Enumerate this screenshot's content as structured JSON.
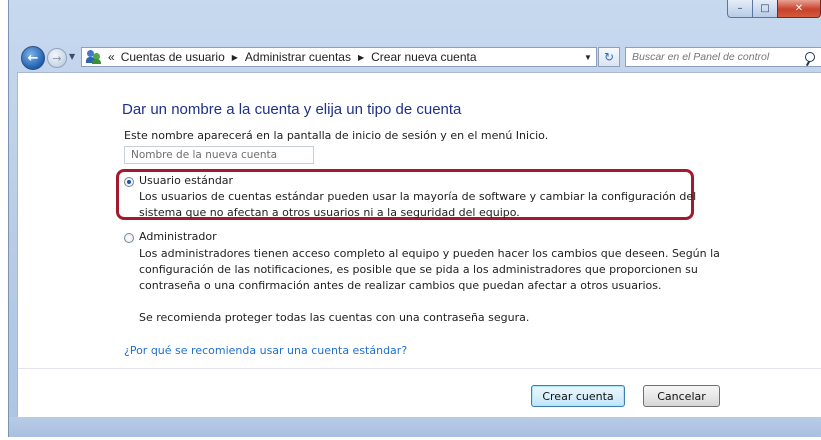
{
  "window": {
    "minimize_glyph": "–",
    "maximize_glyph": "□",
    "close_glyph": "✕"
  },
  "nav": {
    "back_glyph": "←",
    "forward_glyph": "→",
    "breadcrumb_prefix": "«",
    "breadcrumb": [
      "Cuentas de usuario",
      "Administrar cuentas",
      "Crear nueva cuenta"
    ],
    "refresh_glyph": "↻",
    "search_placeholder": "Buscar en el Panel de control"
  },
  "main": {
    "title": "Dar un nombre a la cuenta y elija un tipo de cuenta",
    "subtitle": "Este nombre aparecerá en la pantalla de inicio de sesión y en el menú Inicio.",
    "name_placeholder": "Nombre de la nueva cuenta",
    "options": [
      {
        "label": "Usuario estándar",
        "selected": true,
        "description": [
          "Los usuarios de cuentas estándar pueden usar la mayoría de software y cambiar la configuración del",
          "sistema que no afectan a otros usuarios ni a la seguridad del equipo."
        ]
      },
      {
        "label": "Administrador",
        "selected": false,
        "description": [
          "Los administradores tienen acceso completo al equipo y pueden hacer los cambios que deseen. Según la",
          "configuración de las notificaciones, es posible que se pida a los administradores que proporcionen su",
          "contraseña o una confirmación antes de realizar cambios que puedan afectar a otros usuarios."
        ]
      }
    ],
    "recommendation": "Se recomienda proteger todas las cuentas con una contraseña segura.",
    "help_link": "¿Por qué se recomienda usar una cuenta estándar?",
    "highlight_color": "#a3192e"
  },
  "footer": {
    "create_label": "Crear cuenta",
    "cancel_label": "Cancelar"
  }
}
